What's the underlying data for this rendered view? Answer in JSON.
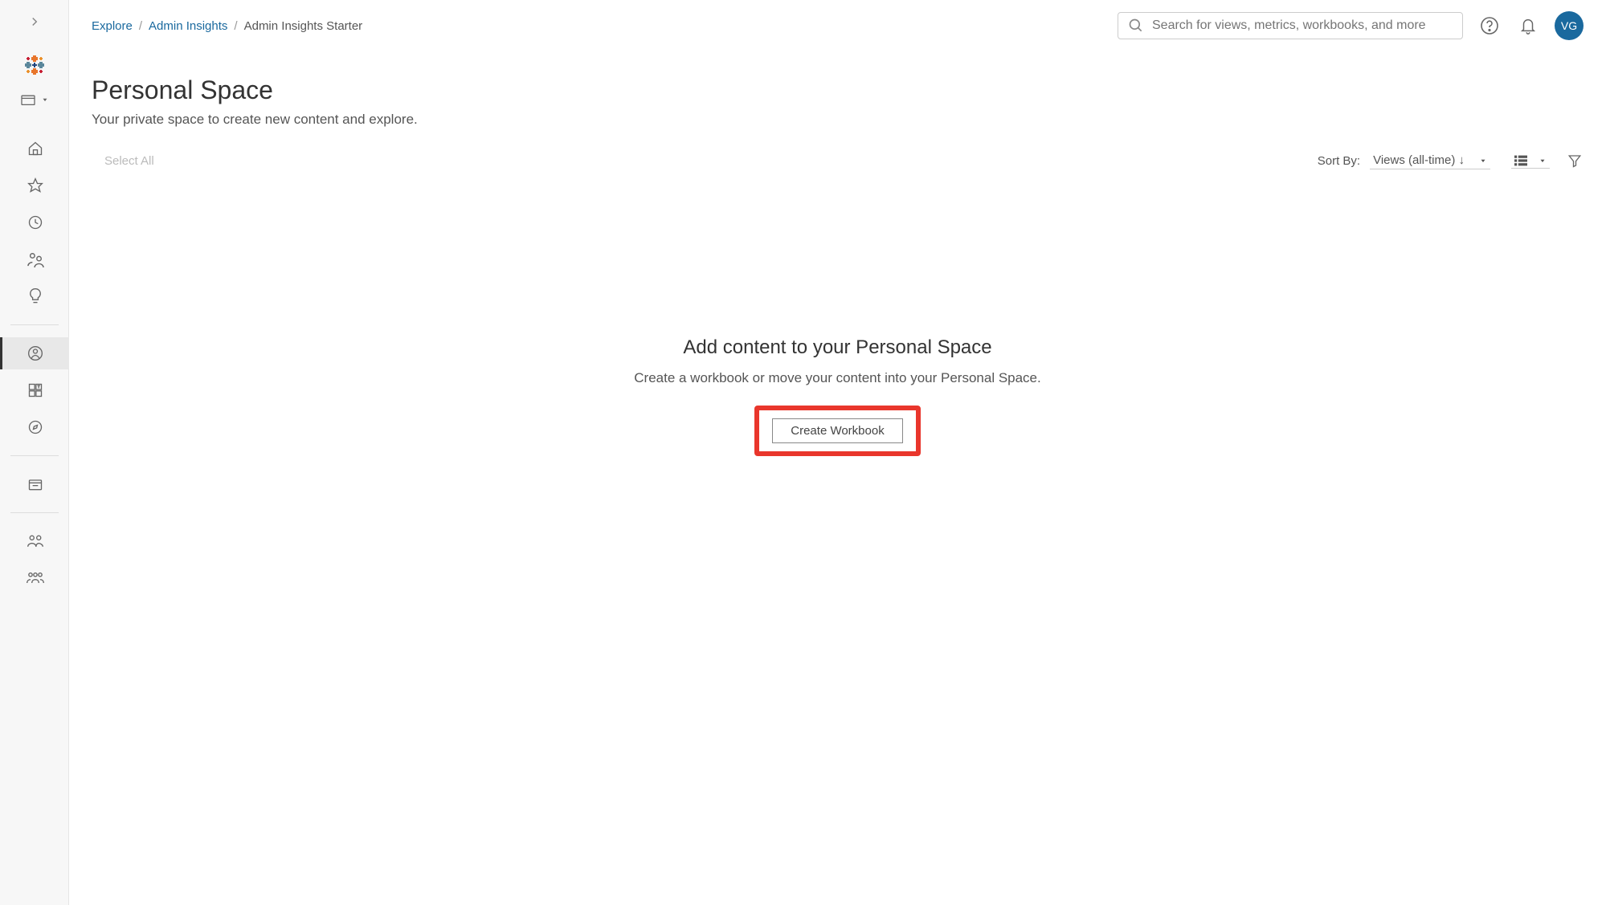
{
  "breadcrumb": {
    "root": "Explore",
    "parent": "Admin Insights",
    "current": "Admin Insights Starter"
  },
  "search": {
    "placeholder": "Search for views, metrics, workbooks, and more"
  },
  "user": {
    "initials": "VG"
  },
  "page": {
    "title": "Personal Space",
    "subtitle": "Your private space to create new content and explore."
  },
  "toolbar": {
    "select_all": "Select All",
    "sort_label": "Sort By:",
    "sort_value": "Views (all-time) ↓"
  },
  "empty": {
    "title": "Add content to your Personal Space",
    "subtitle": "Create a workbook or move your content into your Personal Space.",
    "create_button": "Create Workbook"
  }
}
